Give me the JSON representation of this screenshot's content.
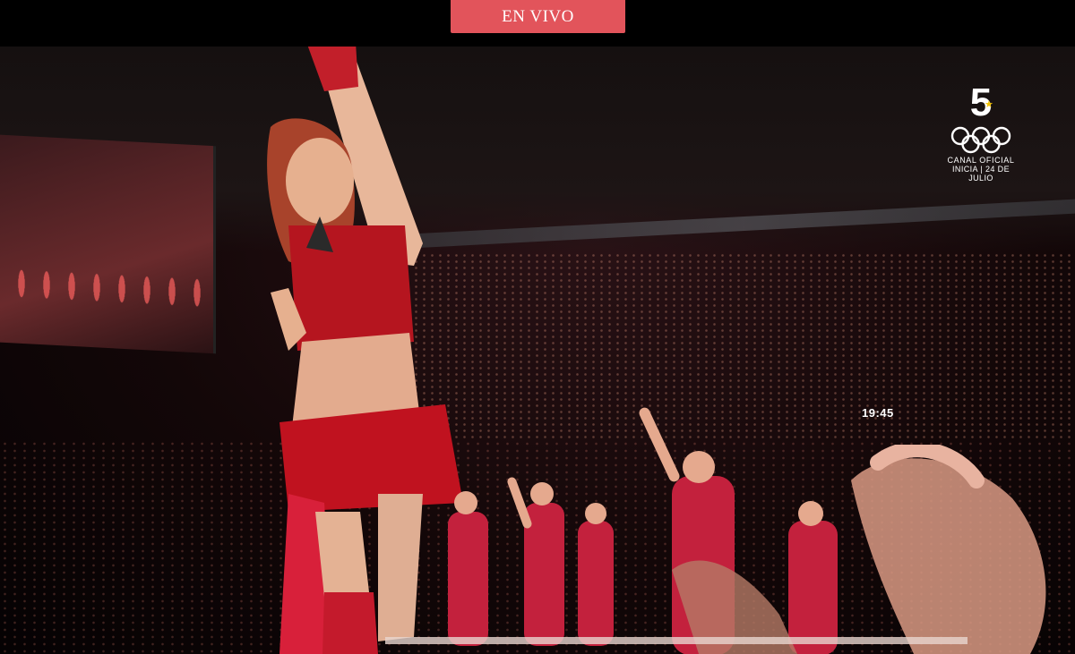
{
  "header": {
    "live_label": "EN VIVO",
    "live_color": "#e2545b"
  },
  "broadcast": {
    "channel_number": "5",
    "channel_line1": "CANAL OFICIAL",
    "channel_line2": "INICIA | 24 DE JULIO",
    "clock": "19:45",
    "icons": [
      "olympic-rings-icon",
      "star-icon"
    ]
  }
}
